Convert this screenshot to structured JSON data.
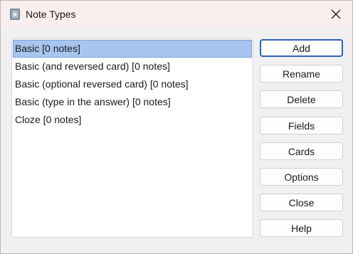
{
  "window": {
    "title": "Note Types",
    "icon": "anki-app-icon",
    "close_icon": "close-icon"
  },
  "note_types": [
    {
      "label": "Basic [0 notes]",
      "selected": true
    },
    {
      "label": "Basic (and reversed card) [0 notes]",
      "selected": false
    },
    {
      "label": "Basic (optional reversed card) [0 notes]",
      "selected": false
    },
    {
      "label": "Basic (type in the answer) [0 notes]",
      "selected": false
    },
    {
      "label": "Cloze [0 notes]",
      "selected": false
    }
  ],
  "buttons": {
    "add": "Add",
    "rename": "Rename",
    "delete": "Delete",
    "fields": "Fields",
    "cards": "Cards",
    "options": "Options",
    "close": "Close",
    "help": "Help"
  },
  "colors": {
    "selection": "#a7c5ef",
    "default_button_border": "#2f62b8"
  }
}
